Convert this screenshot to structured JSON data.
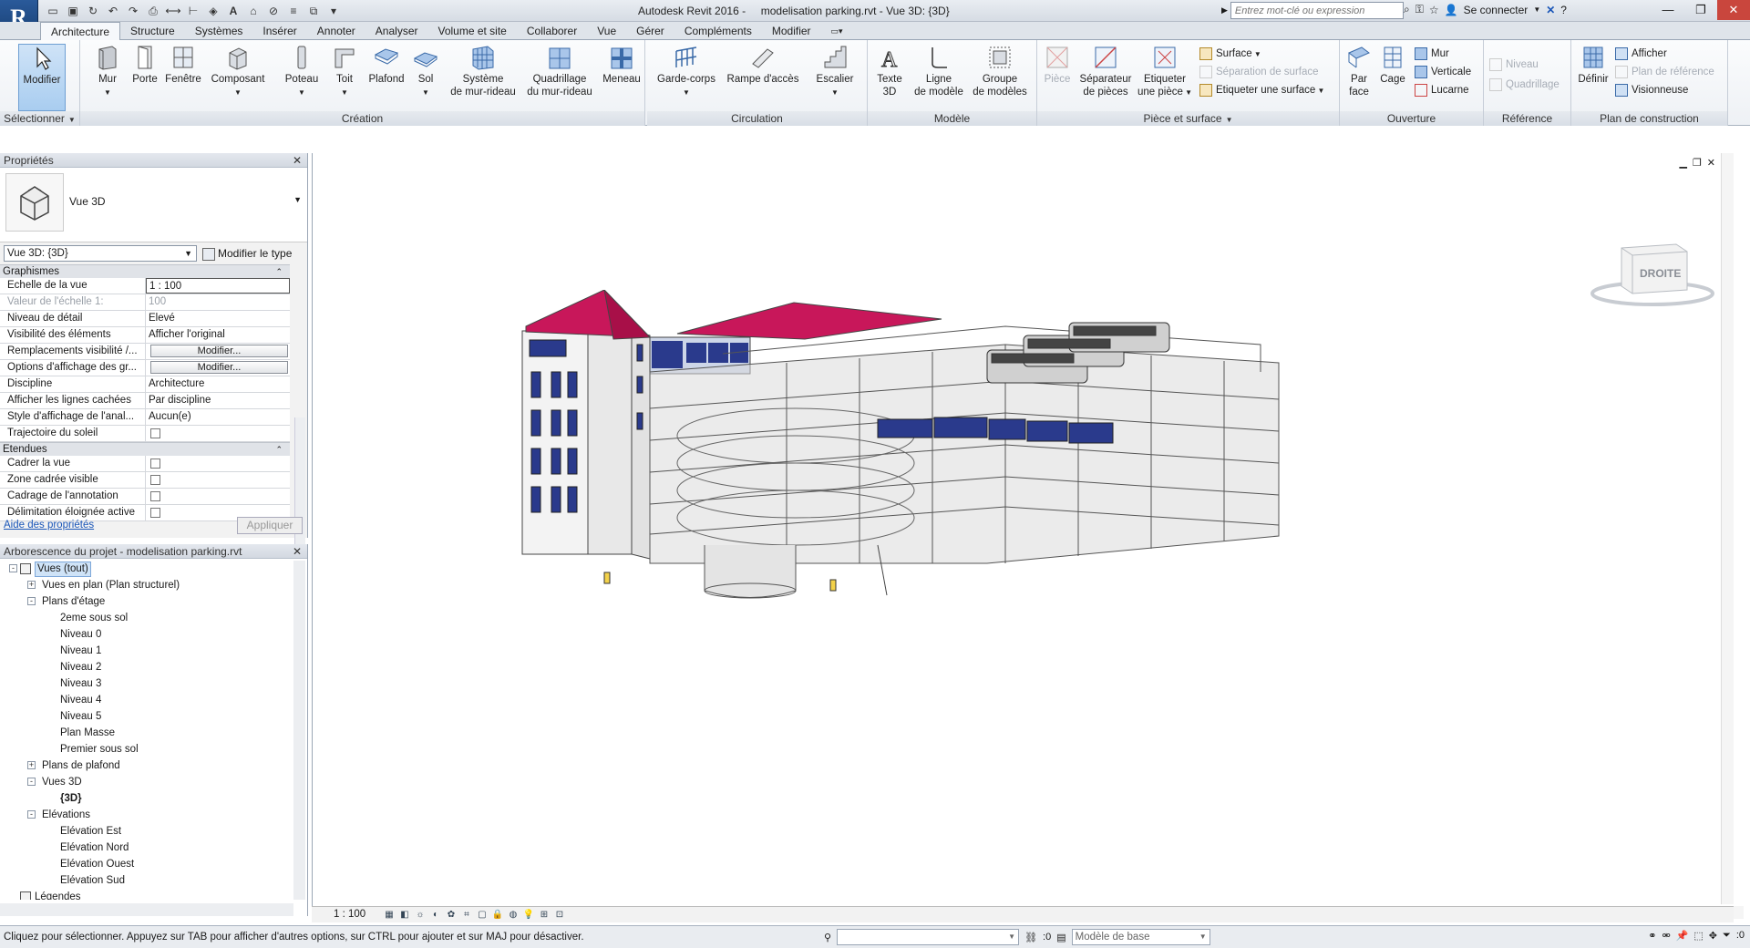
{
  "app": {
    "logo": "R",
    "title": "Autodesk Revit 2016 -     modelisation parking.rvt - Vue 3D: {3D}",
    "search_placeholder": "Entrez mot-clé ou expression",
    "signin": "Se connecter",
    "qat_icons": [
      "open-icon",
      "save-icon",
      "sync-icon",
      "undo-icon",
      "redo-icon",
      "print-icon",
      "measure-icon",
      "dimension-icon",
      "tag-icon",
      "text-icon",
      "3d-view-icon",
      "section-icon",
      "thin-lines-icon",
      "close-hidden-icon",
      "switch-windows-icon"
    ]
  },
  "tabs": [
    "Architecture",
    "Structure",
    "Systèmes",
    "Insérer",
    "Annoter",
    "Analyser",
    "Volume et site",
    "Collaborer",
    "Vue",
    "Gérer",
    "Compléments",
    "Modifier"
  ],
  "active_tab": "Architecture",
  "ribbon": {
    "select": {
      "button": "Modifier",
      "label": "Sélectionner"
    },
    "creation": {
      "label": "Création",
      "buttons": [
        {
          "l1": "Mur",
          "l2": ""
        },
        {
          "l1": "Porte",
          "l2": ""
        },
        {
          "l1": "Fenêtre",
          "l2": ""
        },
        {
          "l1": "Composant",
          "l2": ""
        },
        {
          "l1": "Poteau",
          "l2": ""
        },
        {
          "l1": "Toit",
          "l2": ""
        },
        {
          "l1": "Plafond",
          "l2": ""
        },
        {
          "l1": "Sol",
          "l2": ""
        },
        {
          "l1": "Système",
          "l2": "de mur-rideau"
        },
        {
          "l1": "Quadrillage",
          "l2": "du mur-rideau"
        },
        {
          "l1": "Meneau",
          "l2": ""
        }
      ]
    },
    "circulation": {
      "label": "Circulation",
      "buttons": [
        {
          "l1": "Garde-corps",
          "l2": ""
        },
        {
          "l1": "Rampe d'accès",
          "l2": ""
        },
        {
          "l1": "Escalier",
          "l2": ""
        }
      ]
    },
    "modele": {
      "label": "Modèle",
      "buttons": [
        {
          "l1": "Texte",
          "l2": "3D"
        },
        {
          "l1": "Ligne",
          "l2": "de modèle"
        },
        {
          "l1": "Groupe",
          "l2": "de modèles"
        }
      ]
    },
    "piece": {
      "label": "Pièce et surface",
      "buttons": [
        {
          "l1": "Pièce",
          "l2": ""
        },
        {
          "l1": "Séparateur",
          "l2": "de pièces"
        },
        {
          "l1": "Etiqueter",
          "l2": "une pièce"
        }
      ],
      "small": [
        "Surface",
        "Séparation de surface",
        "Etiqueter une surface"
      ]
    },
    "ouverture": {
      "label": "Ouverture",
      "buttons": [
        {
          "l1": "Par",
          "l2": "face"
        },
        {
          "l1": "Cage",
          "l2": ""
        }
      ],
      "small": [
        "Mur",
        "Verticale",
        "Lucarne"
      ]
    },
    "reference": {
      "label": "Référence",
      "small": [
        "Niveau",
        "Quadrillage"
      ]
    },
    "plan": {
      "label": "Plan de construction",
      "button": "Définir",
      "small": [
        "Afficher",
        "Plan de référence",
        "Visionneuse"
      ]
    }
  },
  "properties": {
    "header": "Propriétés",
    "type_name": "Vue 3D",
    "view_selector": "Vue 3D: {3D}",
    "edit_type": "Modifier le type",
    "groups": [
      {
        "name": "Graphismes",
        "rows": [
          {
            "name": "Echelle de la vue",
            "value": "1 : 100",
            "kind": "input"
          },
          {
            "name": "Valeur de l'échelle    1:",
            "value": "100",
            "kind": "dim"
          },
          {
            "name": "Niveau de détail",
            "value": "Elevé",
            "kind": "text"
          },
          {
            "name": "Visibilité des éléments",
            "value": "Afficher l'original",
            "kind": "text"
          },
          {
            "name": "Remplacements visibilité /...",
            "value": "Modifier...",
            "kind": "button"
          },
          {
            "name": "Options d'affichage des gr...",
            "value": "Modifier...",
            "kind": "button"
          },
          {
            "name": "Discipline",
            "value": "Architecture",
            "kind": "text"
          },
          {
            "name": "Afficher les lignes cachées",
            "value": "Par discipline",
            "kind": "text"
          },
          {
            "name": "Style d'affichage de l'anal...",
            "value": "Aucun(e)",
            "kind": "text"
          },
          {
            "name": "Trajectoire du soleil",
            "value": "",
            "kind": "check"
          }
        ]
      },
      {
        "name": "Etendues",
        "rows": [
          {
            "name": "Cadrer la vue",
            "value": "",
            "kind": "check"
          },
          {
            "name": "Zone cadrée visible",
            "value": "",
            "kind": "check"
          },
          {
            "name": "Cadrage de l'annotation",
            "value": "",
            "kind": "check"
          },
          {
            "name": "Délimitation éloignée active",
            "value": "",
            "kind": "check"
          }
        ]
      }
    ],
    "help": "Aide des propriétés",
    "apply": "Appliquer"
  },
  "browser": {
    "header": "Arborescence du projet - modelisation parking.rvt",
    "nodes": [
      {
        "label": "Vues (tout)",
        "level": 0,
        "toggle": "-",
        "selected": true,
        "icon": true
      },
      {
        "label": "Vues en plan (Plan structurel)",
        "level": 1,
        "toggle": "+"
      },
      {
        "label": "Plans d'étage",
        "level": 1,
        "toggle": "-"
      },
      {
        "label": "2eme sous sol",
        "level": 2
      },
      {
        "label": "Niveau 0",
        "level": 2
      },
      {
        "label": "Niveau 1",
        "level": 2
      },
      {
        "label": "Niveau 2",
        "level": 2
      },
      {
        "label": "Niveau 3",
        "level": 2
      },
      {
        "label": "Niveau 4",
        "level": 2
      },
      {
        "label": "Niveau 5",
        "level": 2
      },
      {
        "label": "Plan Masse",
        "level": 2
      },
      {
        "label": "Premier sous sol",
        "level": 2
      },
      {
        "label": "Plans de plafond",
        "level": 1,
        "toggle": "+"
      },
      {
        "label": "Vues 3D",
        "level": 1,
        "toggle": "-"
      },
      {
        "label": "{3D}",
        "level": 2,
        "bold": true
      },
      {
        "label": "Elévations",
        "level": 1,
        "toggle": "-"
      },
      {
        "label": "Elévation Est",
        "level": 2
      },
      {
        "label": "Elévation Nord",
        "level": 2
      },
      {
        "label": "Elévation Ouest",
        "level": 2
      },
      {
        "label": "Elévation Sud",
        "level": 2
      },
      {
        "label": "Légendes",
        "level": 0,
        "icon": true
      }
    ]
  },
  "viewcube": {
    "face": "DROITE"
  },
  "viewbar": {
    "scale": "1 : 100"
  },
  "status": {
    "text": "Cliquez pour sélectionner. Appuyez sur TAB pour afficher d'autres options, sur CTRL pour ajouter et sur MAJ pour désactiver.",
    "filter_count": ":0",
    "model": "Modèle de base",
    "right_count": ":0"
  },
  "colors": {
    "roof": "#c8175a",
    "glass": "#2a3a8c",
    "accent": "#2a5a9a"
  }
}
